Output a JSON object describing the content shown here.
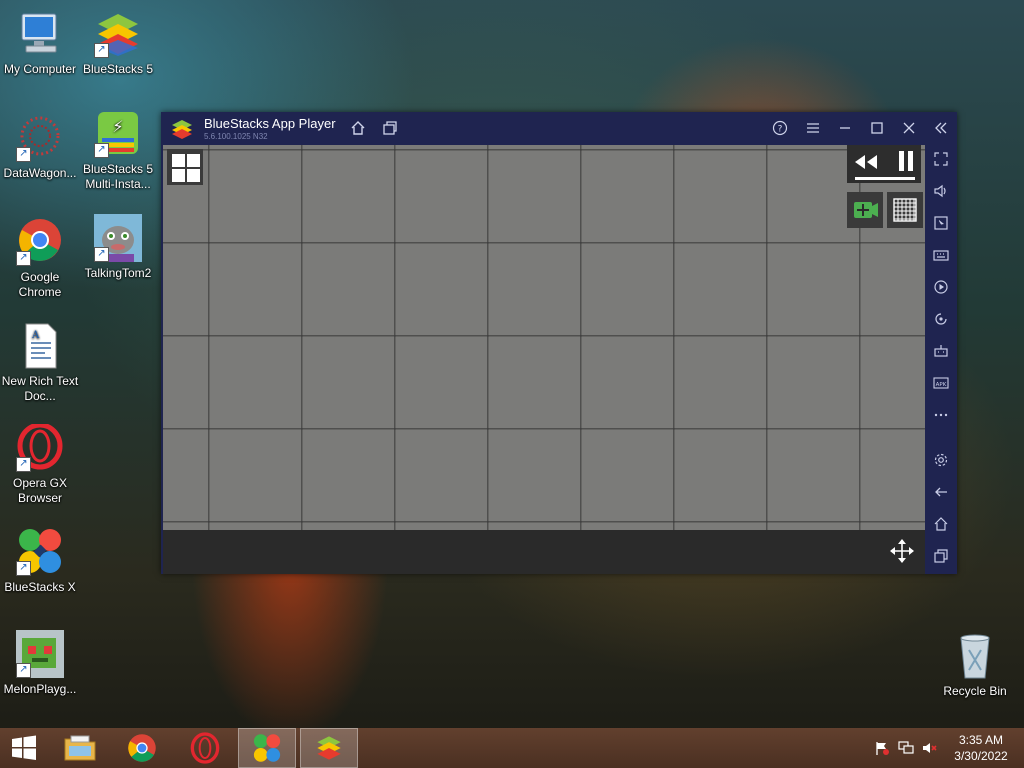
{
  "desktop": {
    "icons": [
      {
        "name": "my-computer",
        "label": "My Computer"
      },
      {
        "name": "bluestacks5",
        "label": "BlueStacks 5"
      },
      {
        "name": "datawagon",
        "label": "DataWagon..."
      },
      {
        "name": "bluestacks5-multi",
        "label": "BlueStacks 5 Multi-Insta..."
      },
      {
        "name": "google-chrome",
        "label": "Google Chrome"
      },
      {
        "name": "talkingtom2",
        "label": "TalkingTom2"
      },
      {
        "name": "new-rich-text",
        "label": "New Rich Text Doc..."
      },
      {
        "name": "opera-gx",
        "label": "Opera GX Browser"
      },
      {
        "name": "bluestacks-x",
        "label": "BlueStacks X"
      },
      {
        "name": "melon-playground",
        "label": "MelonPlayg..."
      },
      {
        "name": "recycle-bin",
        "label": "Recycle Bin"
      }
    ]
  },
  "window": {
    "title": "BlueStacks App Player",
    "version": "5.6.100.1025 N32",
    "accent": "#1f2450"
  },
  "taskbar": {
    "clock_time": "3:35 AM",
    "clock_date": "3/30/2022"
  },
  "icons": {
    "start": "windows-start-icon",
    "explorer": "file-explorer-icon",
    "chrome": "chrome-icon",
    "opera": "opera-gx-icon",
    "bluestacks_x": "bluestacks-x-icon",
    "bluestacks": "bluestacks-icon"
  }
}
